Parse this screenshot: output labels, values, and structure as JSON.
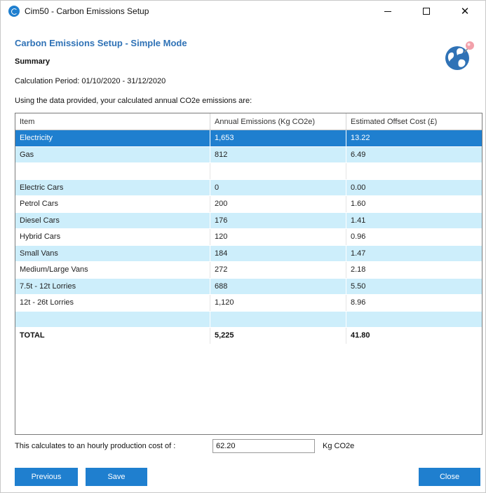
{
  "window": {
    "title": "Cim50 - Carbon Emissions Setup",
    "icon": "app-globe-icon"
  },
  "header": {
    "heading": "Carbon Emissions Setup - Simple Mode",
    "summary": "Summary",
    "period": "Calculation Period: 01/10/2020 - 31/12/2020",
    "intro": "Using the data provided, your calculated annual CO2e emissions are:"
  },
  "grid": {
    "columns": [
      "Item",
      "Annual Emissions (Kg CO2e)",
      "Estimated Offset Cost (£)"
    ],
    "rows": [
      {
        "item": "Electricity",
        "emissions": "1,653",
        "cost": "13.22"
      },
      {
        "item": "Gas",
        "emissions": "812",
        "cost": "6.49"
      },
      {
        "item": "",
        "emissions": "",
        "cost": ""
      },
      {
        "item": "Electric Cars",
        "emissions": "0",
        "cost": "0.00"
      },
      {
        "item": "Petrol Cars",
        "emissions": "200",
        "cost": "1.60"
      },
      {
        "item": "Diesel Cars",
        "emissions": "176",
        "cost": "1.41"
      },
      {
        "item": "Hybrid Cars",
        "emissions": "120",
        "cost": "0.96"
      },
      {
        "item": "Small Vans",
        "emissions": "184",
        "cost": "1.47"
      },
      {
        "item": "Medium/Large Vans",
        "emissions": "272",
        "cost": "2.18"
      },
      {
        "item": "7.5t - 12t Lorries",
        "emissions": "688",
        "cost": "5.50"
      },
      {
        "item": "12t - 26t Lorries",
        "emissions": "1,120",
        "cost": "8.96"
      },
      {
        "item": "",
        "emissions": "",
        "cost": ""
      },
      {
        "item": "TOTAL",
        "emissions": "5,225",
        "cost": "41.80"
      }
    ]
  },
  "footer": {
    "hourly_label": "This calculates to an hourly production cost of :",
    "hourly_value": "62.20",
    "hourly_unit": "Kg CO2e",
    "previous_label": "Previous",
    "save_label": "Save",
    "close_label": "Close"
  },
  "colors": {
    "accent": "#1f7fcf",
    "heading": "#2f72b6",
    "row_alt": "#cdeefb"
  }
}
